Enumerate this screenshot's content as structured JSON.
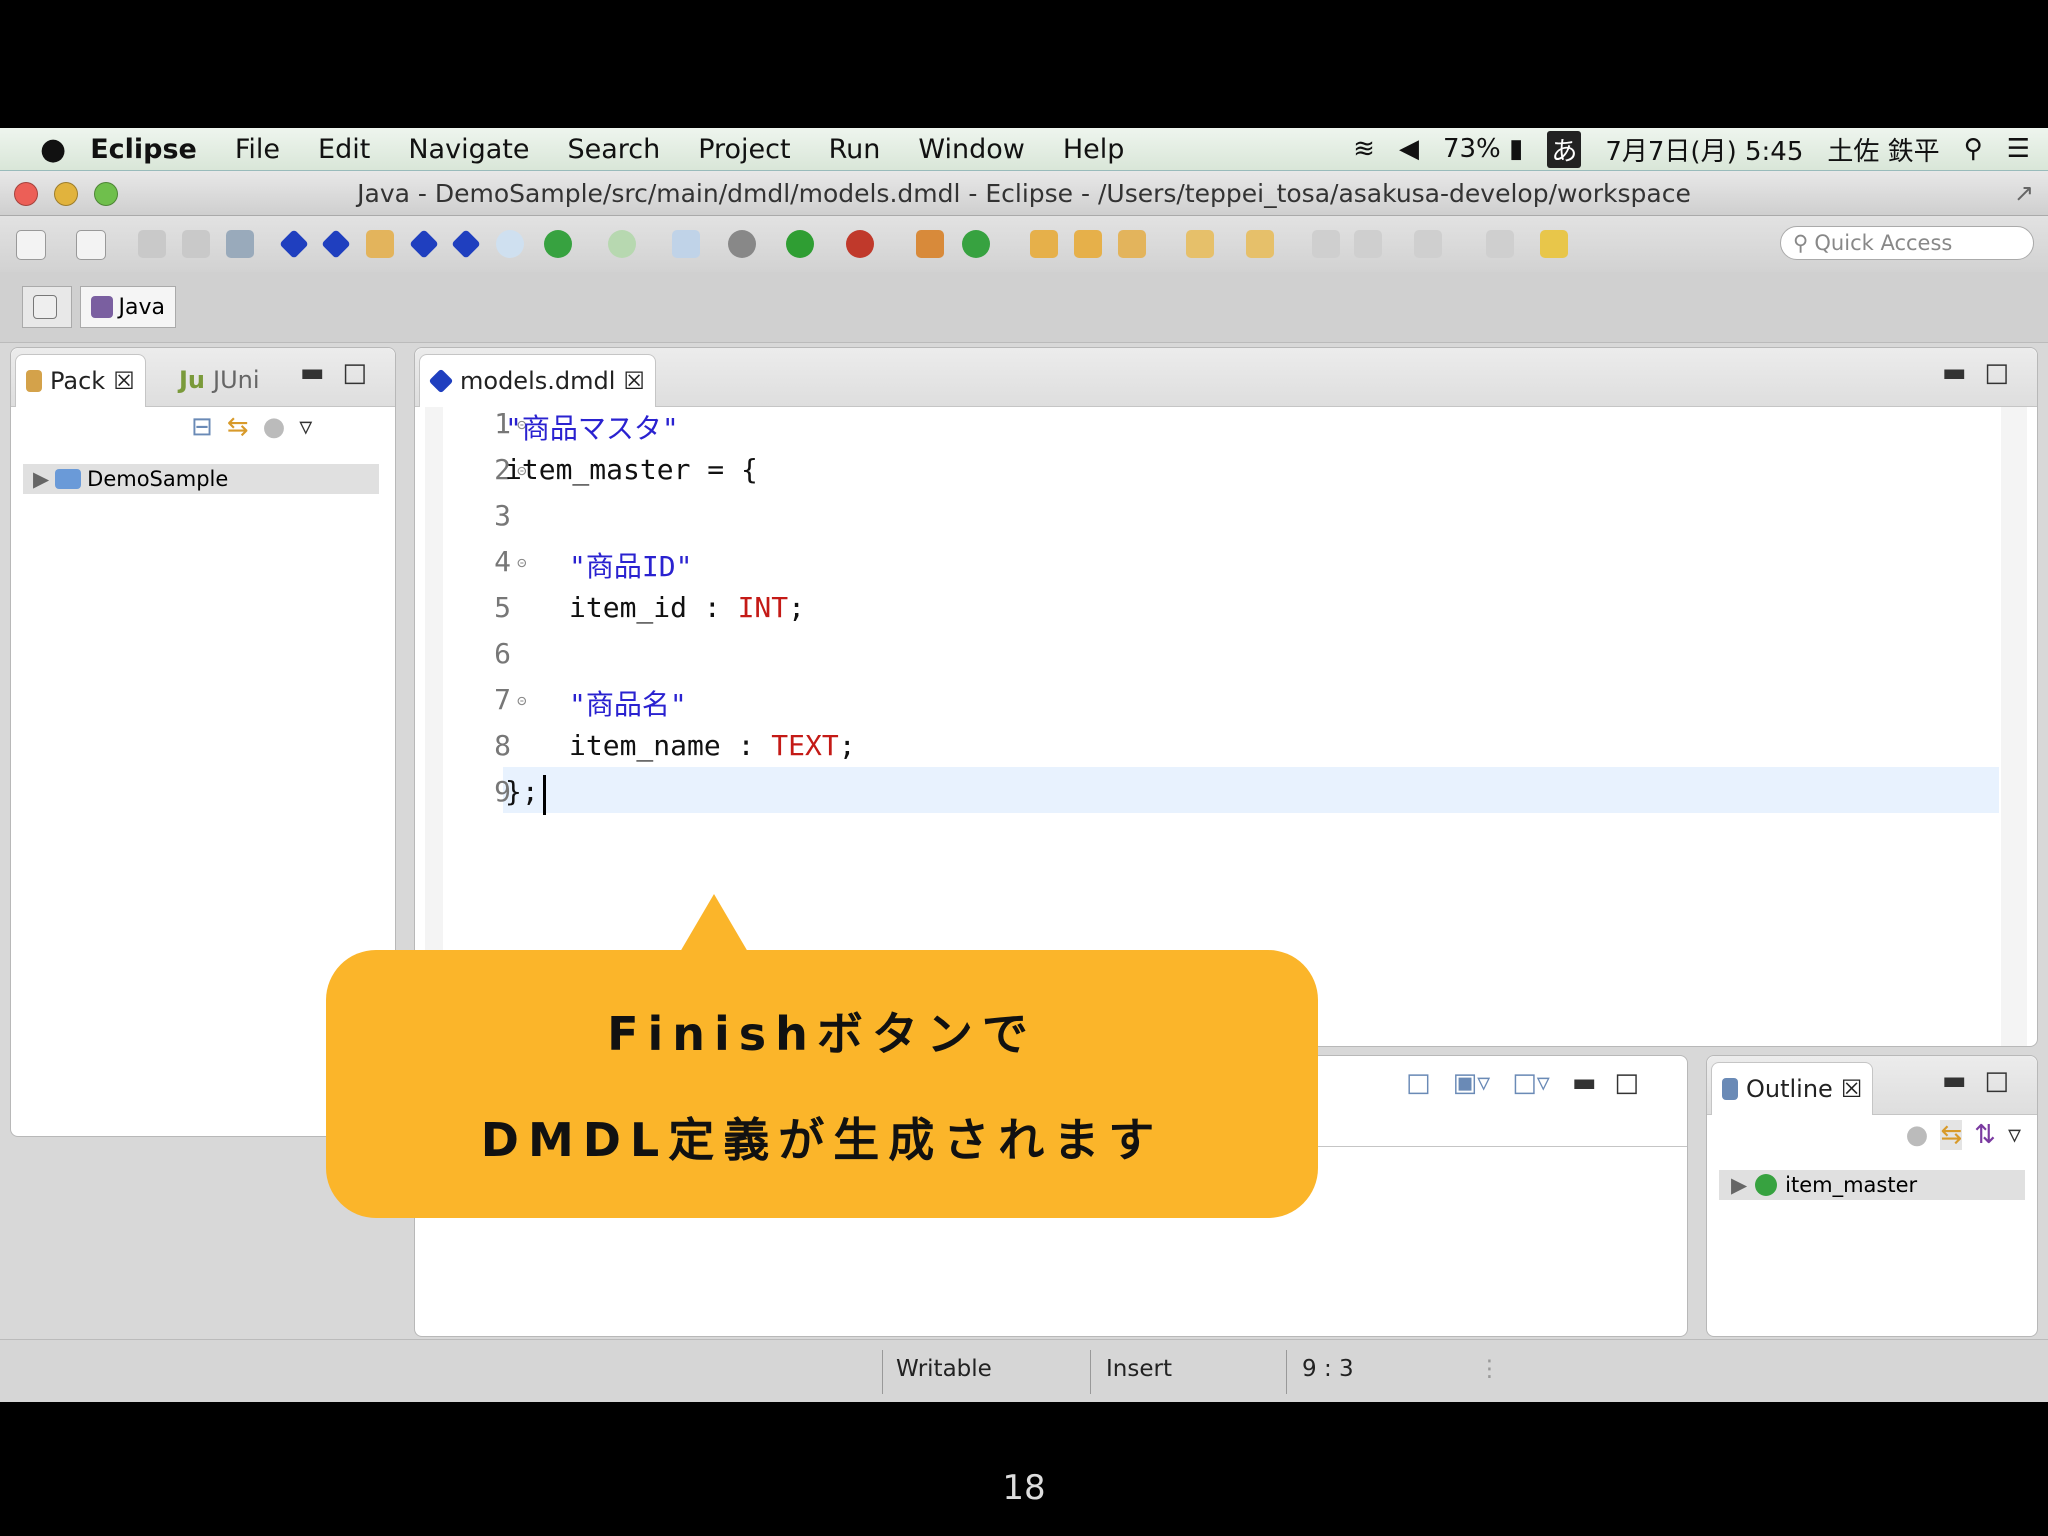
{
  "menubar": {
    "app": "Eclipse",
    "items": [
      "File",
      "Edit",
      "Navigate",
      "Search",
      "Project",
      "Run",
      "Window",
      "Help"
    ],
    "battery": "73%",
    "input_method": "あ",
    "datetime": "7月7日(月) 5:45",
    "user": "土佐 鉄平"
  },
  "window": {
    "title": "Java - DemoSample/src/main/dmdl/models.dmdl - Eclipse - /Users/teppei_tosa/asakusa-develop/workspace"
  },
  "toolbar": {
    "quick_access_placeholder": "Quick Access"
  },
  "perspective": {
    "java_label": "Java"
  },
  "package_explorer": {
    "tab_label": "Pack",
    "junit_tab_label": "JUni",
    "project": "DemoSample"
  },
  "editor": {
    "tab_label": "models.dmdl",
    "lines": [
      {
        "num": "1",
        "parts": [
          {
            "t": "\"商品マスタ\"",
            "c": "str"
          }
        ],
        "indent": 0
      },
      {
        "num": "2",
        "parts": [
          {
            "t": "item_master = {",
            "c": ""
          }
        ],
        "indent": 0
      },
      {
        "num": "3",
        "parts": [],
        "indent": 0
      },
      {
        "num": "4",
        "parts": [
          {
            "t": "\"商品ID\"",
            "c": "str"
          }
        ],
        "indent": 1
      },
      {
        "num": "5",
        "parts": [
          {
            "t": "item_id : ",
            "c": ""
          },
          {
            "t": "INT",
            "c": "kw"
          },
          {
            "t": ";",
            "c": ""
          }
        ],
        "indent": 1
      },
      {
        "num": "6",
        "parts": [],
        "indent": 0
      },
      {
        "num": "7",
        "parts": [
          {
            "t": "\"商品名\"",
            "c": "str"
          }
        ],
        "indent": 1
      },
      {
        "num": "8",
        "parts": [
          {
            "t": "item_name : ",
            "c": ""
          },
          {
            "t": "TEXT",
            "c": "kw"
          },
          {
            "t": ";",
            "c": ""
          }
        ],
        "indent": 1
      },
      {
        "num": "9",
        "parts": [
          {
            "t": "};",
            "c": ""
          }
        ],
        "indent": 0
      }
    ]
  },
  "outline": {
    "tab_label": "Outline",
    "item": "item_master"
  },
  "status": {
    "writable": "Writable",
    "insert": "Insert",
    "position": "9 : 3"
  },
  "callout": {
    "line1": "Finishボタンで",
    "line2": "DMDL定義が生成されます"
  },
  "slide": {
    "page_number": "18"
  },
  "colors": {
    "callout": "#fbb52a",
    "string": "#2a22d0",
    "keyword": "#c41a16",
    "current_line": "#e8f2fe"
  }
}
